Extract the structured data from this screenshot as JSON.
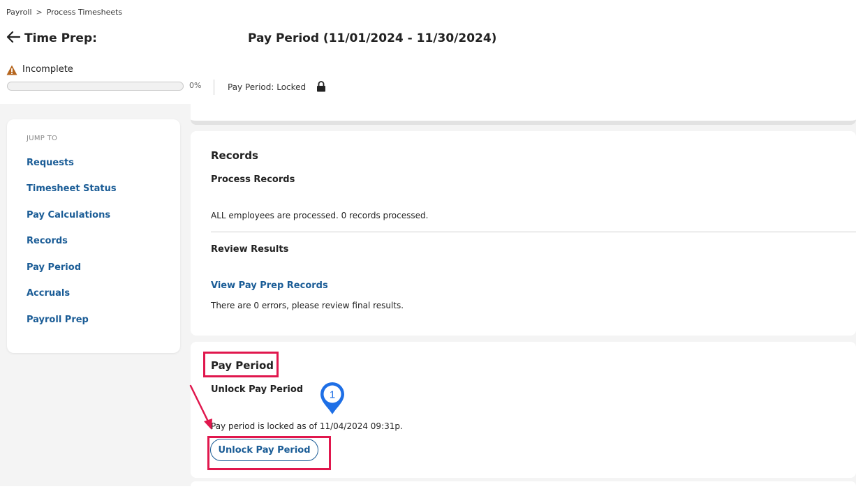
{
  "breadcrumb": {
    "root": "Payroll",
    "separator": ">",
    "current": "Process Timesheets"
  },
  "header": {
    "back_icon": "arrow-left-icon",
    "title": "Time Prep:",
    "period_title": "Pay Period (11/01/2024 - 11/30/2024)"
  },
  "status": {
    "icon": "warning-icon",
    "label": "Incomplete",
    "progress": 0,
    "progress_text": "0%",
    "lock_status": "Pay Period: Locked",
    "lock_icon": "lock-icon"
  },
  "jump_to": {
    "heading": "JUMP TO",
    "items": [
      "Requests",
      "Timesheet Status",
      "Pay Calculations",
      "Records",
      "Pay Period",
      "Accruals",
      "Payroll Prep"
    ]
  },
  "records": {
    "title": "Records",
    "process_title": "Process Records",
    "process_text": "ALL employees are processed. 0 records processed.",
    "review_title": "Review Results",
    "review_link": "View Pay Prep Records",
    "review_text": "There are 0 errors, please review final results."
  },
  "pay_period": {
    "title": "Pay Period",
    "unlock_title": "Unlock Pay Period",
    "locked_text": "Pay period is locked as of 11/04/2024 09:31p.",
    "unlock_button": "Unlock Pay Period"
  },
  "annotations": {
    "step_number": "1",
    "highlight_color": "#e0174d",
    "marker_color": "#1e6fe6"
  },
  "colors": {
    "link": "#1a5c96",
    "warning": "#b5651d",
    "background": "#f4f4f4"
  }
}
